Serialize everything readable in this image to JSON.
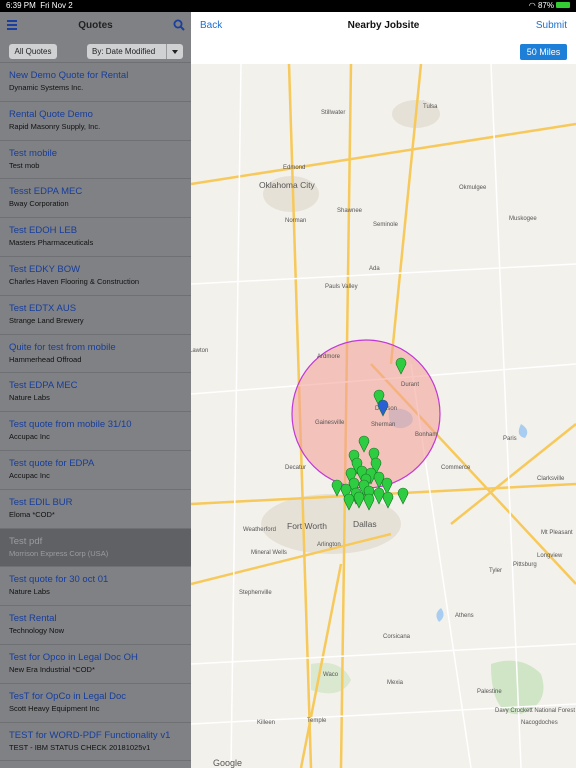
{
  "status": {
    "time": "6:39 PM",
    "date": "Fri Nov 2",
    "battery": "87%"
  },
  "left": {
    "title": "Quotes",
    "filter_all": "All Quotes",
    "filter_sort": "By: Date Modified",
    "items": [
      {
        "title": "New Demo Quote for Rental",
        "sub": "Dynamic Systems Inc."
      },
      {
        "title": "Rental Quote Demo",
        "sub": "Rapid Masonry Supply, Inc."
      },
      {
        "title": "Test mobile",
        "sub": "Test mob"
      },
      {
        "title": "Tesst EDPA MEC",
        "sub": "Bway Corporation"
      },
      {
        "title": "Test EDOH LEB",
        "sub": "Masters Pharmaceuticals"
      },
      {
        "title": "Test EDKY BOW",
        "sub": "Charles Haven Flooring & Construction"
      },
      {
        "title": "Test EDTX AUS",
        "sub": "Strange Land Brewery"
      },
      {
        "title": "Quite for test from mobile",
        "sub": "Hammerhead Offroad"
      },
      {
        "title": "Test EDPA MEC",
        "sub": "Nature Labs"
      },
      {
        "title": "Test quote from mobile 31/10",
        "sub": "Accupac Inc"
      },
      {
        "title": "Test quote for EDPA",
        "sub": "Accupac Inc"
      },
      {
        "title": "Test EDIL BUR",
        "sub": "Eloma *COD*"
      },
      {
        "title": "Test pdf",
        "sub": "Morrison Express Corp (USA)"
      },
      {
        "title": "Test quote for 30 oct 01",
        "sub": "Nature Labs"
      },
      {
        "title": "Test Rental",
        "sub": "Technology Now"
      },
      {
        "title": "Test for Opco in Legal Doc OH",
        "sub": "New Era Industrial *COD*"
      },
      {
        "title": "TesT for OpCo in Legal Doc",
        "sub": "Scott Heavy Equipment Inc"
      },
      {
        "title": "TEST for WORD-PDF Functionality v1",
        "sub": "TEST - IBM STATUS CHECK 20181025v1"
      }
    ]
  },
  "right": {
    "back": "Back",
    "title": "Nearby Jobsite",
    "submit": "Submit",
    "radius": "50 Miles"
  },
  "map": {
    "cities": [
      {
        "name": "Oklahoma City",
        "big": true
      },
      {
        "name": "Fort Worth",
        "big": true
      },
      {
        "name": "Dallas",
        "big": true
      },
      {
        "name": "Tulsa"
      },
      {
        "name": "Stillwater"
      },
      {
        "name": "Edmond"
      },
      {
        "name": "Norman"
      },
      {
        "name": "Shawnee"
      },
      {
        "name": "Seminole"
      },
      {
        "name": "Okmulgee"
      },
      {
        "name": "Muskogee"
      },
      {
        "name": "Ada"
      },
      {
        "name": "Lawton"
      },
      {
        "name": "Pauls Valley"
      },
      {
        "name": "Ardmore"
      },
      {
        "name": "Durant"
      },
      {
        "name": "Denison"
      },
      {
        "name": "Sherman"
      },
      {
        "name": "Gainesville"
      },
      {
        "name": "Paris"
      },
      {
        "name": "Clarksville"
      },
      {
        "name": "Commerce"
      },
      {
        "name": "Decatur"
      },
      {
        "name": "Weatherford"
      },
      {
        "name": "Arlington"
      },
      {
        "name": "Mt Pleasant"
      },
      {
        "name": "Pittsburg"
      },
      {
        "name": "Stephenville"
      },
      {
        "name": "Corsicana"
      },
      {
        "name": "Athens"
      },
      {
        "name": "Tyler"
      },
      {
        "name": "Longview"
      },
      {
        "name": "Waco"
      },
      {
        "name": "Mexia"
      },
      {
        "name": "Palestine"
      },
      {
        "name": "Nacogdoches"
      },
      {
        "name": "Killeen"
      },
      {
        "name": "Temple"
      },
      {
        "name": "Davy Crockett National Forest"
      },
      {
        "name": "Mineral Wells"
      },
      {
        "name": "Bonham"
      }
    ],
    "google": "Google"
  },
  "colors": {
    "accent": "#1b6fd1",
    "pin": "#2ecc40",
    "circle": "#c039d6"
  }
}
